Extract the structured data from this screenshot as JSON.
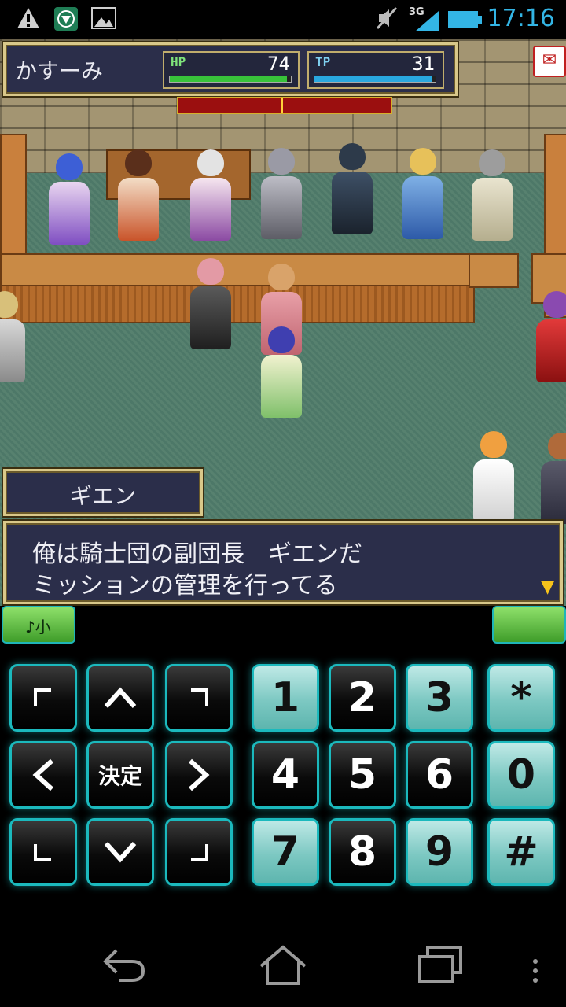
{
  "status_bar": {
    "time": "17:16",
    "network": "3G",
    "icons": [
      "warning-icon",
      "shield-app-icon",
      "image-icon",
      "mute-icon",
      "signal-icon",
      "battery-icon"
    ]
  },
  "hud": {
    "player_name": "かすーみ",
    "hp_label": "HP",
    "hp_value": "74",
    "hp_fill": 0.97,
    "tp_label": "TP",
    "tp_value": "31",
    "tp_fill": 0.97,
    "mail_icon": "mail-icon"
  },
  "dialog": {
    "speaker": "ギエン",
    "line1": "俺は騎士団の副団長　ギエンだ",
    "line2": "ミッションの管理を行ってる",
    "next_icon": "▼"
  },
  "controls": {
    "left_soft_label": "♪小",
    "right_soft_label": "",
    "dpad": {
      "center_label": "決定"
    },
    "keypad": [
      "1",
      "2",
      "3",
      "*",
      "4",
      "5",
      "6",
      "0",
      "7",
      "8",
      "9",
      "#"
    ]
  },
  "colors": {
    "hp_bar": "#38c23a",
    "tp_bar": "#29a8e0",
    "accent": "#1bb9bd",
    "status_time": "#33b5e5"
  }
}
